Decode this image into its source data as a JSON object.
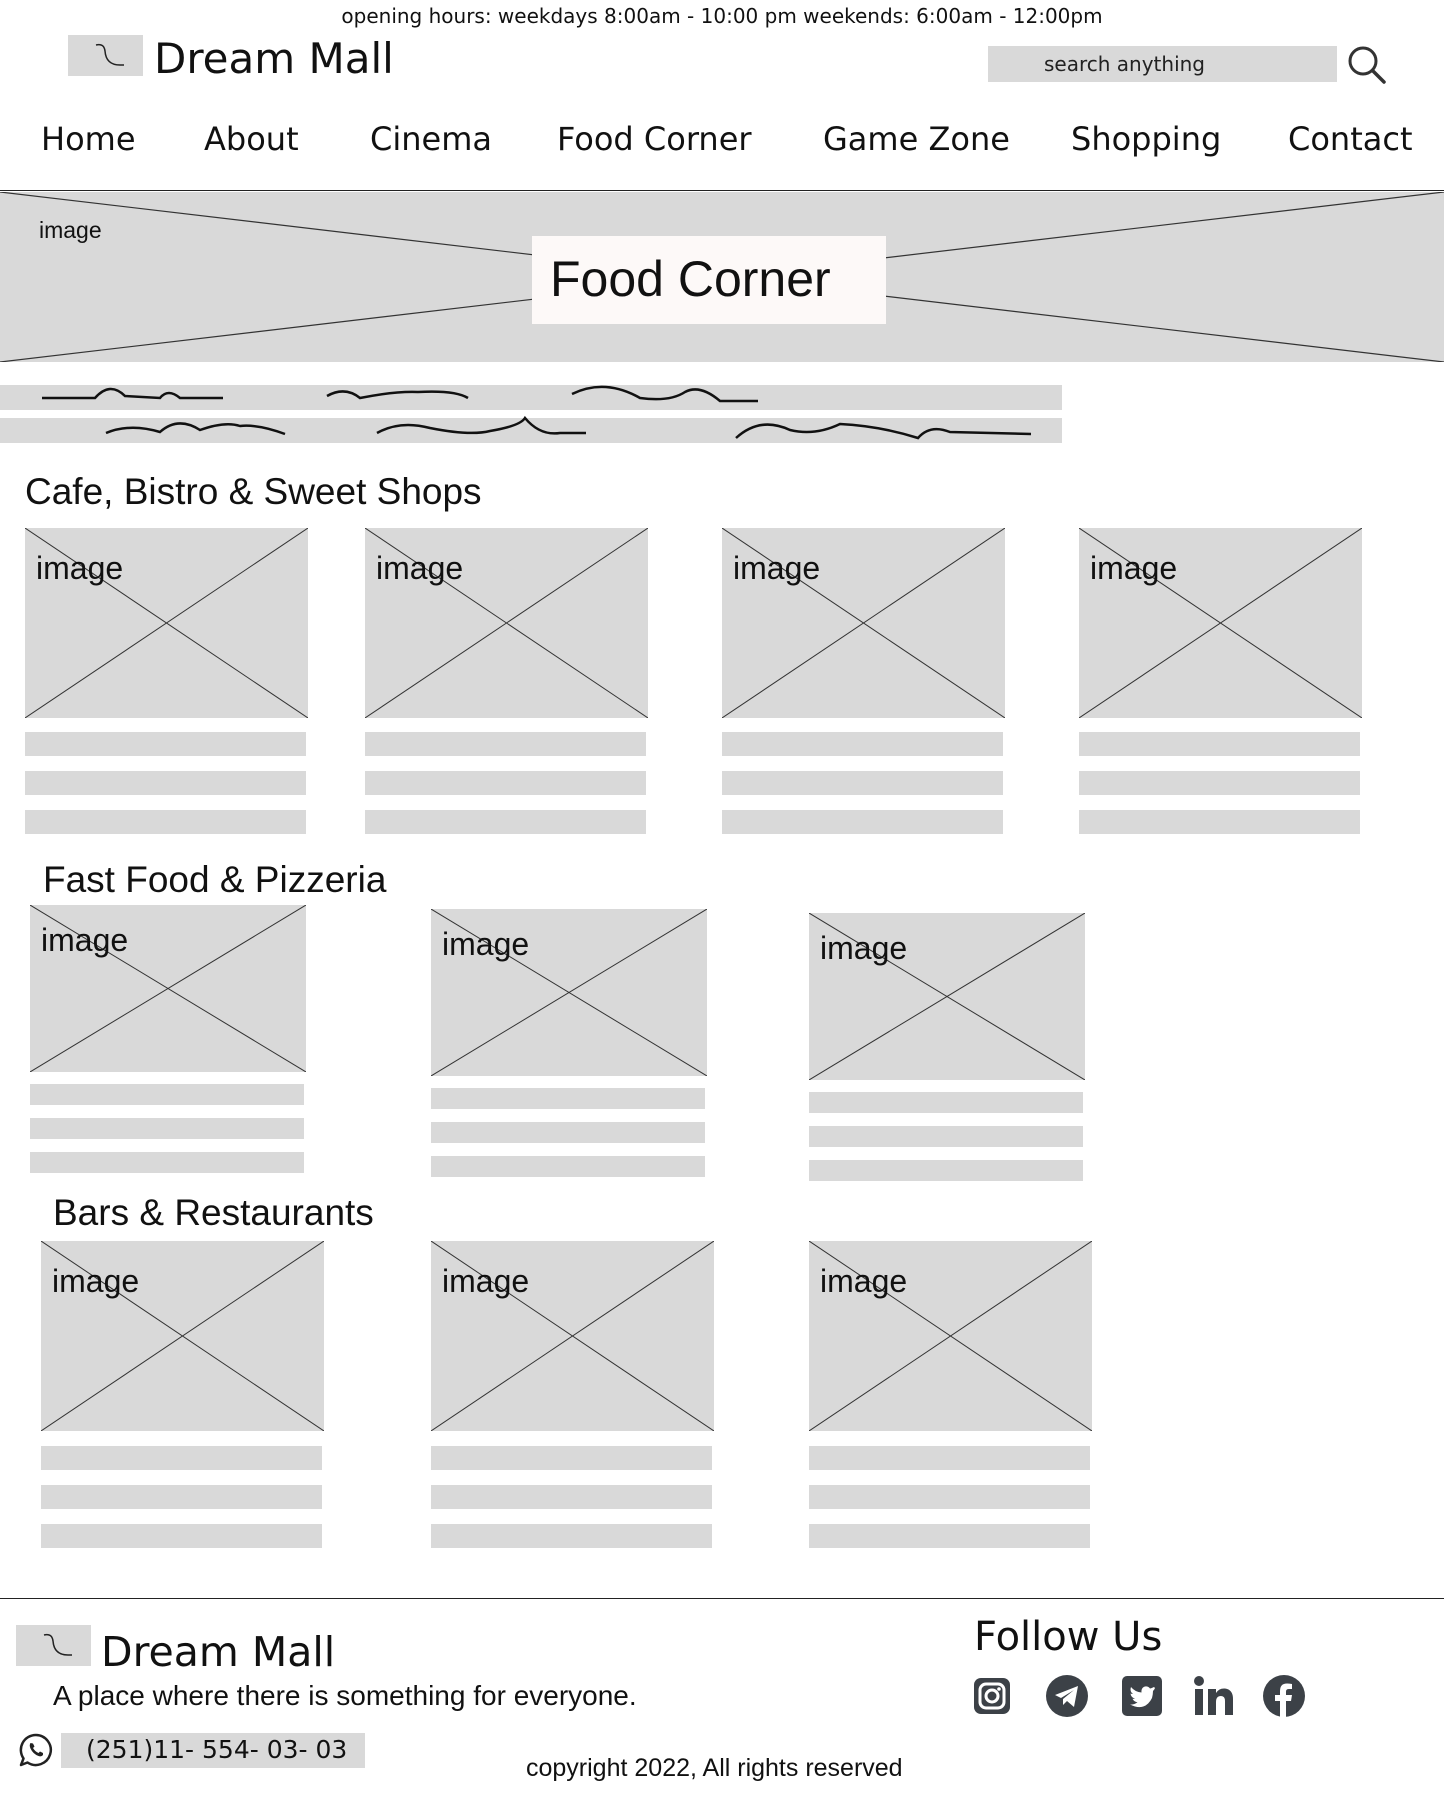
{
  "header": {
    "hours": "opening hours: weekdays 8:00am - 10:00 pm  weekends: 6:00am - 12:00pm",
    "brand": "Dream Mall",
    "search_placeholder": "search anything"
  },
  "nav": {
    "items": [
      "Home",
      "About",
      "Cinema",
      "Food Corner",
      "Game Zone",
      "Shopping",
      "Contact"
    ]
  },
  "hero": {
    "image_label": "image",
    "title": "Food Corner"
  },
  "placeholder_label": "image",
  "sections": [
    {
      "title": "Cafe, Bistro & Sweet Shops"
    },
    {
      "title": "Fast Food & Pizzeria"
    },
    {
      "title": "Bars & Restaurants"
    }
  ],
  "footer": {
    "brand": "Dream Mall",
    "tagline": "A place where there is something for everyone.",
    "phone": "(251)11- 554- 03- 03",
    "follow_title": "Follow Us",
    "copyright": "copyright 2022, All rights reserved",
    "social_icons": [
      "instagram-icon",
      "telegram-icon",
      "twitter-icon",
      "linkedin-icon",
      "facebook-icon"
    ]
  }
}
